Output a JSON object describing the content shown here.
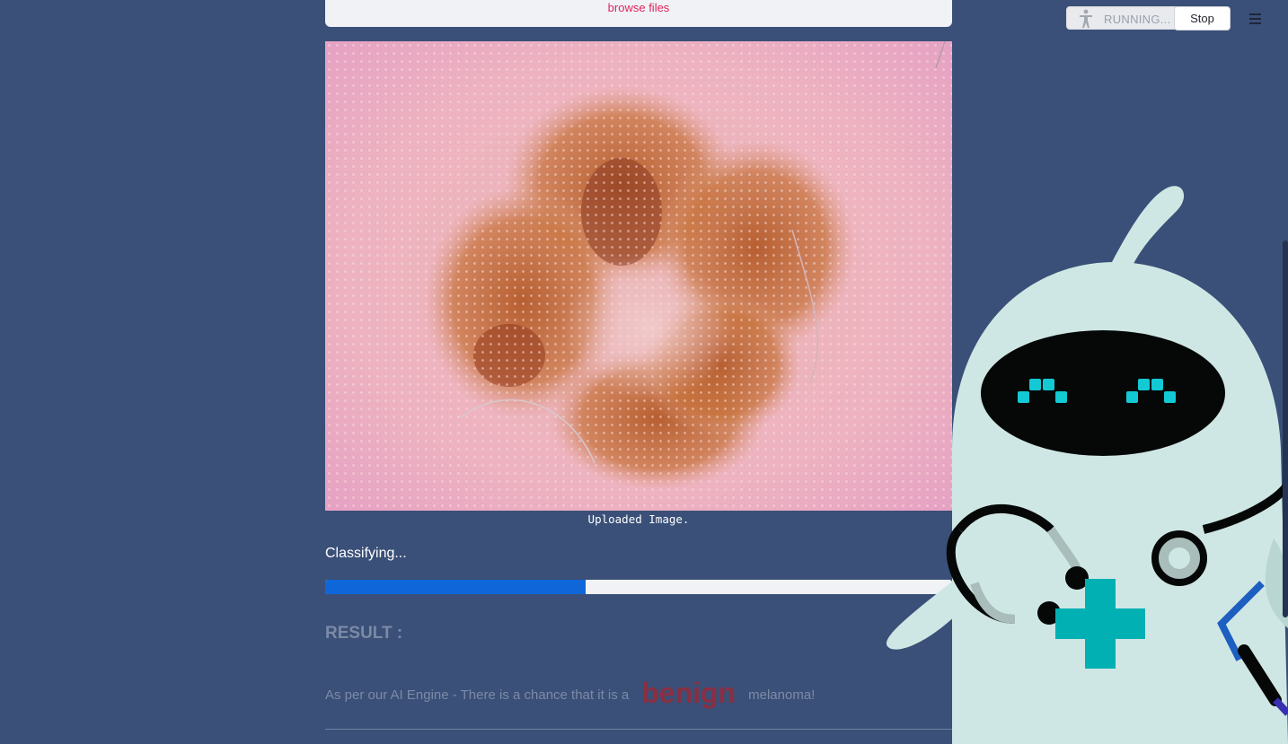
{
  "uploader": {
    "browse_label": "browse files"
  },
  "status": {
    "running_label": "RUNNING...",
    "stop_label": "Stop"
  },
  "image": {
    "caption": "Uploaded Image."
  },
  "progress": {
    "label": "Classifying...",
    "fraction": 0.415,
    "fill_color": "#0e66d8"
  },
  "result": {
    "title": "RESULT :",
    "prefix": "As per our AI Engine - There is a chance that it is a",
    "verdict": "benign",
    "suffix": "melanoma!",
    "verdict_color": "#8a2f42"
  },
  "colors": {
    "background": "#3a5078",
    "link": "#e0245e",
    "robot_body": "#cfe7e4",
    "robot_accent": "#00b0b3"
  },
  "icons": {
    "running": "running-man-icon",
    "menu": "hamburger-menu-icon"
  }
}
